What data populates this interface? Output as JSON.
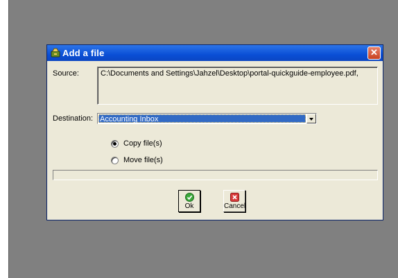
{
  "dialog": {
    "title": "Add a file",
    "close_glyph": "✕",
    "source_label": "Source:",
    "source_value": "C:\\Documents and Settings\\Jahzel\\Desktop\\portal-quickguide-employee.pdf,",
    "destination_label": "Destination:",
    "destination_value": "Accounting Inbox",
    "options": {
      "copy_label": "Copy file(s)",
      "move_label": "Move file(s)",
      "selected": "copy"
    },
    "progress_value": 0,
    "ok_label": "Ok",
    "cancel_label": "Cancel"
  },
  "icons": {
    "app": "app-icon",
    "ok": "checkmark-icon",
    "cancel": "x-icon"
  },
  "colors": {
    "titlebar": "#0a4fd6",
    "selection": "#316ac5",
    "desktop": "#808080",
    "dialog_face": "#ece9d8"
  }
}
